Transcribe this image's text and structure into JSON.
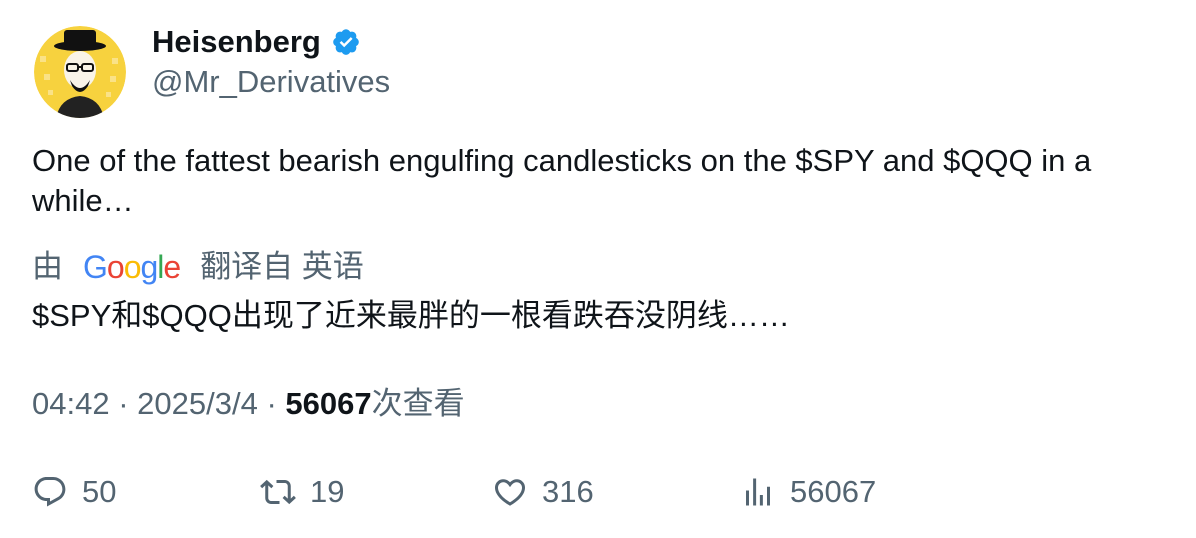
{
  "author": {
    "display_name": "Heisenberg",
    "handle": "@Mr_Derivatives",
    "verified": true,
    "avatar_icon": "heisenberg-avatar-icon"
  },
  "tweet": {
    "text": "One of the fattest bearish engulfing candlesticks on the $SPY and $QQQ in a while…"
  },
  "translation": {
    "prefix": "由",
    "provider": "Google",
    "suffix": "翻译自 英语",
    "text": "$SPY和$QQQ出现了近来最胖的一根看跌吞没阴线……"
  },
  "meta": {
    "time": "04:42",
    "separator": "·",
    "date": "2025/3/4",
    "views_count": "56067",
    "views_label": "次查看"
  },
  "actions": {
    "replies": "50",
    "retweets": "19",
    "likes": "316",
    "views": "56067"
  },
  "colors": {
    "text_primary": "#0f1419",
    "text_secondary": "#536471",
    "verified_blue": "#1d9bf0",
    "avatar_yellow": "#f7d23e"
  }
}
